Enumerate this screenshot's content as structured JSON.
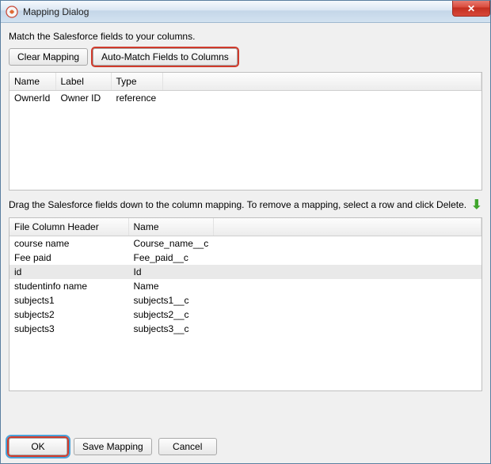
{
  "titlebar": {
    "title": "Mapping Dialog",
    "close_icon": "✕"
  },
  "instructions_top": "Match the Salesforce fields to your columns.",
  "toolbar": {
    "clear_mapping": "Clear Mapping",
    "auto_match": "Auto-Match Fields to Columns"
  },
  "top_table": {
    "headers": {
      "name": "Name",
      "label": "Label",
      "type": "Type"
    },
    "rows": [
      {
        "name": "OwnerId",
        "label": "Owner ID",
        "type": "reference"
      }
    ]
  },
  "instructions_bottom": "Drag the Salesforce fields down to the column mapping.  To remove a mapping, select a row and click Delete.",
  "bottom_table": {
    "headers": {
      "file_col": "File Column Header",
      "name": "Name"
    },
    "rows": [
      {
        "file_col": "course name",
        "name": "Course_name__c",
        "selected": false
      },
      {
        "file_col": "Fee paid",
        "name": "Fee_paid__c",
        "selected": false
      },
      {
        "file_col": "id",
        "name": "Id",
        "selected": true
      },
      {
        "file_col": "studentinfo name",
        "name": "Name",
        "selected": false
      },
      {
        "file_col": "subjects1",
        "name": "subjects1__c",
        "selected": false
      },
      {
        "file_col": "subjects2",
        "name": "subjects2__c",
        "selected": false
      },
      {
        "file_col": "subjects3",
        "name": "subjects3__c",
        "selected": false
      }
    ]
  },
  "footer": {
    "ok": "OK",
    "save_mapping": "Save Mapping",
    "cancel": "Cancel"
  },
  "icons": {
    "down_arrow": "⬇"
  }
}
